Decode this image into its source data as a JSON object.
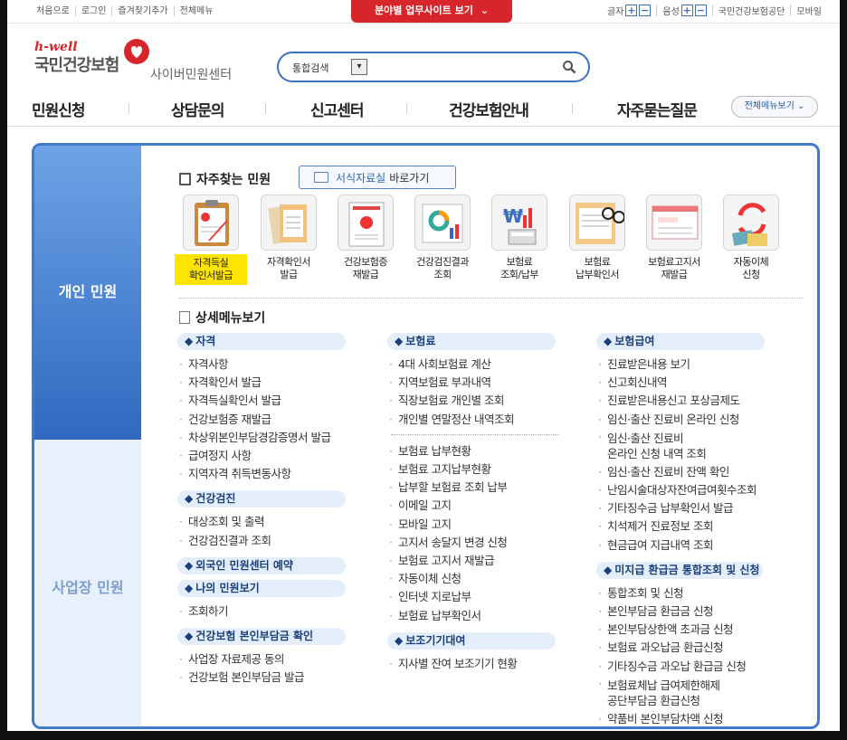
{
  "util": {
    "links": [
      "처음으로",
      "로그인",
      "즐겨찾기추가",
      "전체메뉴"
    ],
    "site_button": "분야별 업무사이트 보기",
    "font_label": "글자",
    "voice_label": "음성",
    "org": "국민건강보험공단",
    "mobile": "모바일"
  },
  "logo": {
    "hwell": "h-well",
    "name": "국민건강보험",
    "sub": "사이버민원센터"
  },
  "search": {
    "category": "통합검색",
    "value": ""
  },
  "gnb": {
    "items": [
      "민원신청",
      "상담문의",
      "신고센터",
      "건강보험안내",
      "자주묻는질문"
    ],
    "all_menu": "전체메뉴보기"
  },
  "tabs": {
    "personal": "개인 민원",
    "business": "사업장 민원"
  },
  "frequent": {
    "title": "자주찾는 민원",
    "forms_prefix": "서식자료실",
    "forms_suffix": "바로가기",
    "items": [
      {
        "l1": "자격득실",
        "l2": "확인서발급",
        "icon": "clipboard-document-icon"
      },
      {
        "l1": "자격확인서",
        "l2": "발급",
        "icon": "documents-icon"
      },
      {
        "l1": "건강보험증",
        "l2": "재발급",
        "icon": "insurance-card-icon"
      },
      {
        "l1": "건강검진결과",
        "l2": "조회",
        "icon": "checkup-chart-icon"
      },
      {
        "l1": "보험료",
        "l2": "조회/납부",
        "icon": "calculator-chart-icon"
      },
      {
        "l1": "보험료",
        "l2": "납부확인서",
        "icon": "receipt-glasses-icon"
      },
      {
        "l1": "보험료고지서",
        "l2": "재발급",
        "icon": "notice-bill-icon"
      },
      {
        "l1": "자동이체",
        "l2": "신청",
        "icon": "auto-transfer-icon"
      }
    ]
  },
  "detail": {
    "title": "상세메뉴보기",
    "col1": {
      "cat1": "자격",
      "cat1_items": [
        "자격사항",
        "자격확인서 발급",
        "자격득실확인서 발급",
        "건강보험증 재발급",
        "차상위본인부담경감증명서 발급",
        "급여정지 사항",
        "지역자격 취득변동사항"
      ],
      "cat2": "건강검진",
      "cat2_items": [
        "대상조회 및 출력",
        "건강검진결과 조회"
      ],
      "cat3": "외국인 민원센터 예약",
      "cat4": "나의 민원보기",
      "cat4_items": [
        "조회하기"
      ],
      "cat5": "건강보험 본인부담금 확인",
      "cat5_items": [
        "사업장 자료제공 동의",
        "건강보험 본인부담금 발급"
      ]
    },
    "col2": {
      "cat1": "보험료",
      "cat1_items_a": [
        "4대 사회보험료 계산",
        "지역보험료 부과내역",
        "직장보험료 개인별 조회",
        "개인별 연말정산 내역조회"
      ],
      "cat1_items_b": [
        "보험료 납부현황",
        "보험료 고지납부현황",
        "납부할 보험료 조회 납부",
        "이메일 고지",
        "모바일 고지",
        "고지서 송달지 변경 신청",
        "보험료 고지서 재발급",
        "자동이체 신청",
        "인터넷 지로납부",
        "보험료 납부확인서"
      ],
      "cat2": "보조기기대여",
      "cat2_items": [
        "지사별 잔여 보조기기 현황"
      ]
    },
    "col3": {
      "cat1": "보험급여",
      "cat1_items": [
        "진료받은내용 보기",
        "신고회신내역",
        "진료받은내용신고 포상금제도",
        "임신·출산 진료비 온라인 신청"
      ],
      "cat1_two_a": "임신·출산 진료비",
      "cat1_two_b": "온라인 신청 내역 조회",
      "cat1_items2": [
        "임신·출산 진료비 잔액 확인",
        "난임시술대상자잔여급여횟수조회",
        "기타징수금 납부확인서 발급",
        "치석제거 진료정보 조회",
        "현금급여 지급내역 조회"
      ],
      "cat2": "미지급 환급금 통합조회 및 신청",
      "cat2_items": [
        "통합조회 및 신청",
        "본인부담금 환급금 신청",
        "본인부담상한액 초과금 신청",
        "보험료 과오납금 환급신청",
        "기타징수금 과오납 환급금 신청"
      ],
      "cat2_two_a": "보험료체납 급여제한해제",
      "cat2_two_b": "공단부담금 환급신청",
      "cat2_last": "약품비 본인부담차액 신청"
    }
  },
  "colors": {
    "accent": "#3f7acb",
    "brand_red": "#d7262b",
    "highlight": "#ffe400"
  }
}
